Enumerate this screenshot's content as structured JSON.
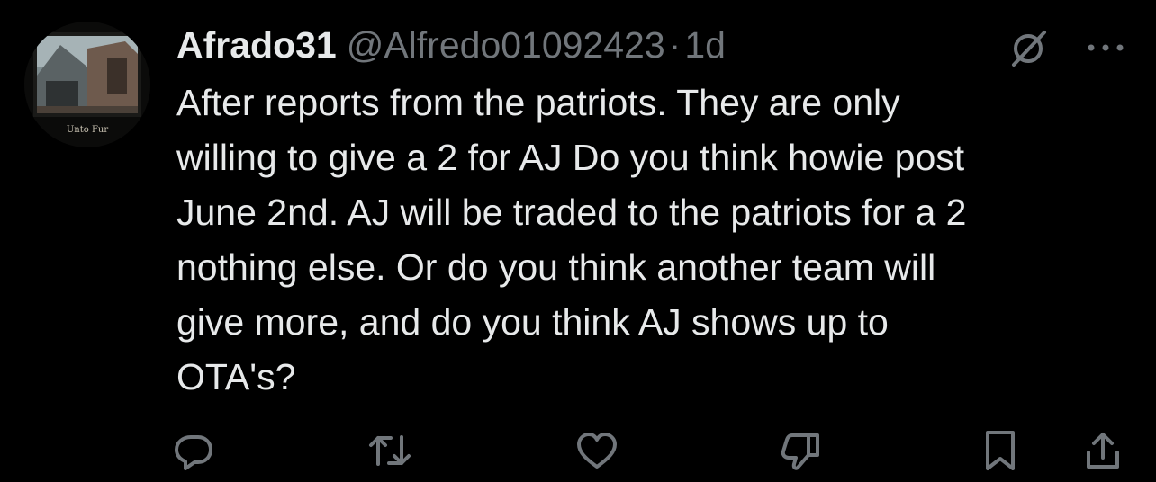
{
  "tweet": {
    "author": {
      "display_name": "Afrado31",
      "handle": "@Alfredo01092423",
      "avatar_caption": "Unto Fur"
    },
    "separator": "·",
    "time": "1d",
    "text": "After reports from the patriots. They are only\nwilling to give a 2 for AJ Do you think howie post\nJune 2nd. AJ will be traded to the patriots for a 2\nnothing else. Or do you think another team will\ngive more, and do you think AJ shows up to\nOTA's?"
  },
  "header_icons": [
    "grok-icon",
    "more-icon"
  ],
  "actions": [
    "reply-icon",
    "retweet-icon",
    "like-icon",
    "dislike-icon",
    "bookmark-icon",
    "share-icon"
  ],
  "colors": {
    "background": "#000000",
    "text": "#e7e9ea",
    "secondary": "#71767b"
  }
}
